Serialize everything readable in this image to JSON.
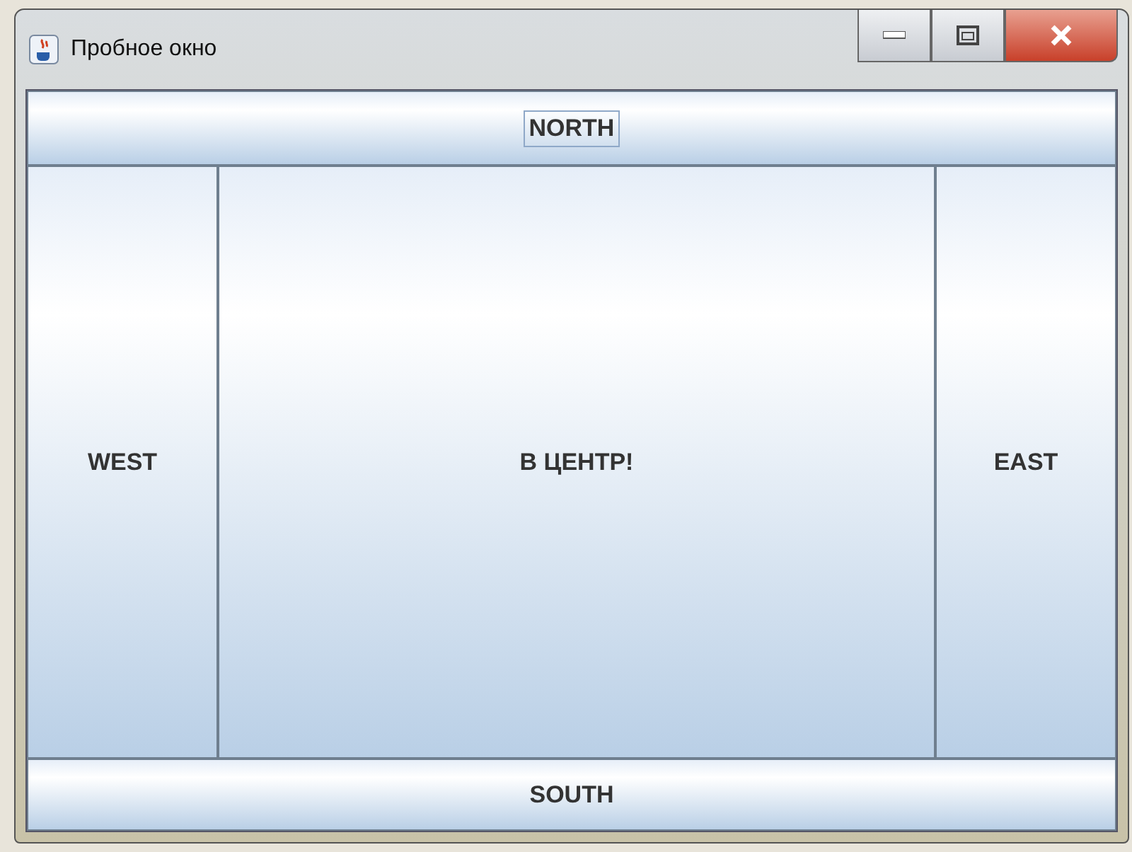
{
  "window": {
    "title": "Пробное окно"
  },
  "buttons": [
    {
      "kind": "north",
      "label": "NORTH",
      "focused": true
    },
    {
      "kind": "west",
      "label": "WEST",
      "focused": false
    },
    {
      "kind": "center",
      "label": "В ЦЕНТР!",
      "focused": false
    },
    {
      "kind": "east",
      "label": "EAST",
      "focused": false
    },
    {
      "kind": "south",
      "label": "SOUTH",
      "focused": false
    }
  ]
}
